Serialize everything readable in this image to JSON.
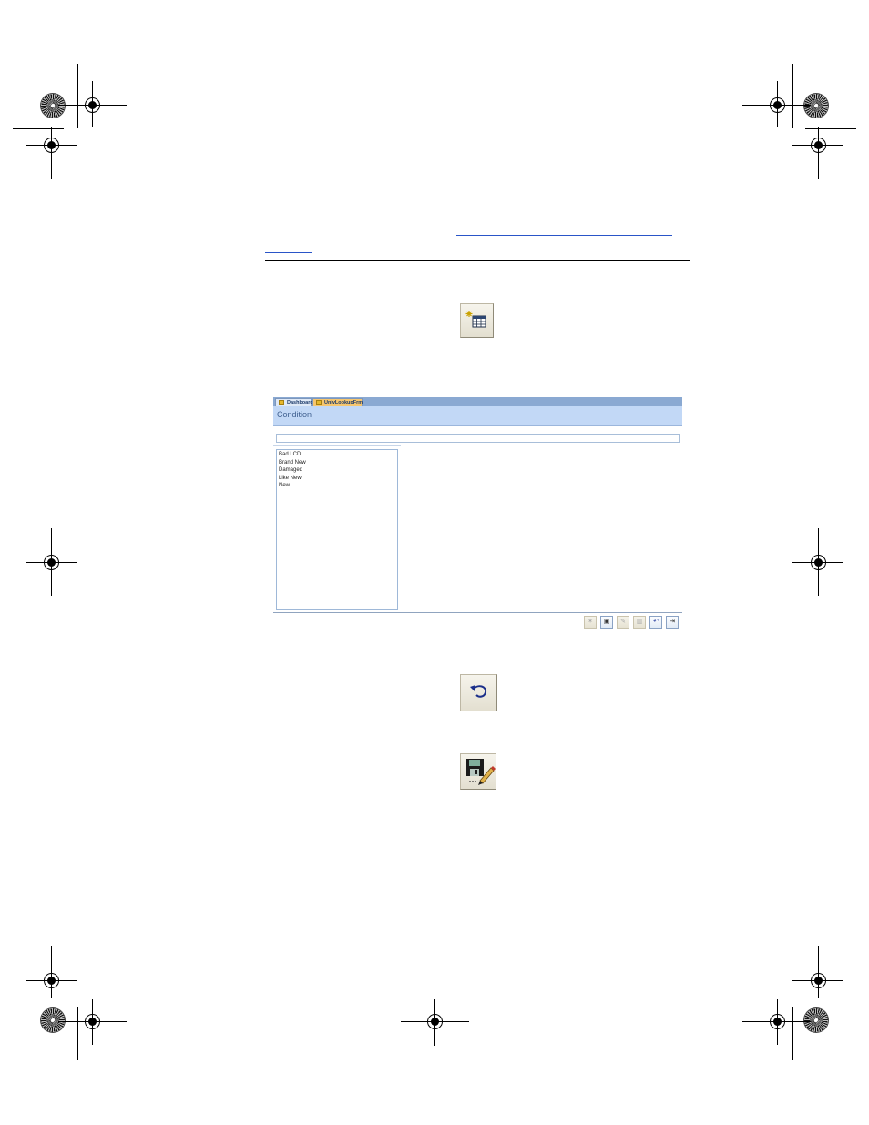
{
  "form_screenshot": {
    "tabs": [
      "Dashboard",
      "UnivLookupFrm"
    ],
    "title": "Condition",
    "list_items": [
      "Bad LCD",
      "Brand New",
      "Damaged",
      "Like New",
      "New"
    ]
  },
  "icons": {
    "new_record": "new-record-icon",
    "undo": "undo-icon",
    "save_edit": "save-edit-icon"
  },
  "colors": {
    "tab_strip": "#8aa9d2",
    "form_header": "#c2d8f6",
    "link": "#2a55c8"
  }
}
